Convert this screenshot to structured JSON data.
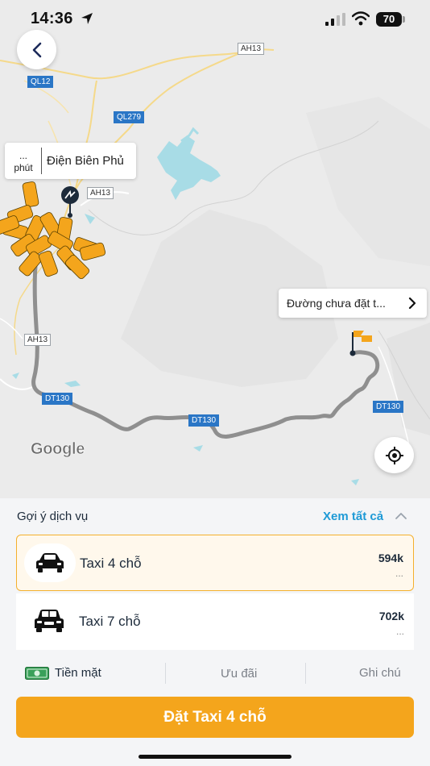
{
  "status_bar": {
    "time": "14:36",
    "battery": "70"
  },
  "map": {
    "road_labels": [
      "AH13",
      "QL12",
      "QL279",
      "AH13",
      "AH13",
      "DT130",
      "DT130",
      "DT130"
    ],
    "eta": {
      "value": "...",
      "unit": "phút",
      "place": "Điện Biên Phủ"
    },
    "destination_label": "Đường chưa đặt t...",
    "attribution": "Google"
  },
  "services": {
    "title": "Gợi ý dịch vụ",
    "see_all": "Xem tất cả",
    "items": [
      {
        "name": "Taxi 4 chỗ",
        "price": "594k",
        "sub": "...",
        "icon": "sedan-icon",
        "selected": true
      },
      {
        "name": "Taxi 7 chỗ",
        "price": "702k",
        "sub": "...",
        "icon": "suv-icon",
        "selected": false
      }
    ]
  },
  "payment": {
    "cash": "Tiền mặt",
    "promo": "Ưu đãi",
    "note": "Ghi chú"
  },
  "book_button": "Đặt Taxi 4 chỗ",
  "colors": {
    "accent": "#f4a51c",
    "link": "#1e9ad6",
    "text": "#1c2a3a",
    "route": "#8f8f8f",
    "water": "#a8dce6"
  }
}
